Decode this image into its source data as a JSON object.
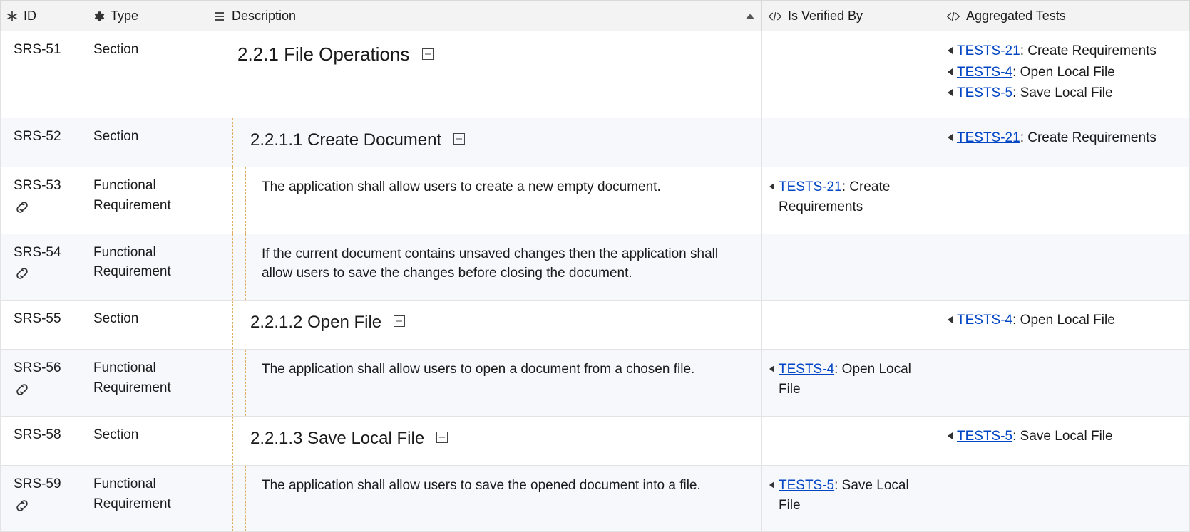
{
  "columns": {
    "id": "ID",
    "type": "Type",
    "description": "Description",
    "is_verified_by": "Is Verified By",
    "aggregated_tests": "Aggregated Tests"
  },
  "rows": [
    {
      "id": "SRS-51",
      "type": "Section",
      "linked": false,
      "level": "h1",
      "guides": 1,
      "heading_no": "2.2.1",
      "heading_text": "File Operations",
      "collapsible": true,
      "verified_by": [],
      "aggregated": [
        {
          "id": "TESTS-21",
          "label": "Create Requirements"
        },
        {
          "id": "TESTS-4",
          "label": "Open Local File"
        },
        {
          "id": "TESTS-5",
          "label": "Save Local File"
        }
      ]
    },
    {
      "id": "SRS-52",
      "type": "Section",
      "linked": false,
      "level": "h2",
      "guides": 2,
      "heading_no": "2.2.1.1",
      "heading_text": "Create Document",
      "collapsible": true,
      "verified_by": [],
      "aggregated": [
        {
          "id": "TESTS-21",
          "label": "Create Requirements"
        }
      ]
    },
    {
      "id": "SRS-53",
      "type": "Functional Requirement",
      "linked": true,
      "level": "txt",
      "guides": 3,
      "text": "The application shall allow users to create a new empty document.",
      "verified_by": [
        {
          "id": "TESTS-21",
          "label": "Create Requirements"
        }
      ],
      "aggregated": []
    },
    {
      "id": "SRS-54",
      "type": "Functional Requirement",
      "linked": true,
      "level": "txt",
      "guides": 3,
      "text": "If the current document contains unsaved changes then the application shall allow users to save the changes before closing the document.",
      "verified_by": [],
      "aggregated": []
    },
    {
      "id": "SRS-55",
      "type": "Section",
      "linked": false,
      "level": "h2",
      "guides": 2,
      "heading_no": "2.2.1.2",
      "heading_text": "Open File",
      "collapsible": true,
      "verified_by": [],
      "aggregated": [
        {
          "id": "TESTS-4",
          "label": "Open Local File"
        }
      ]
    },
    {
      "id": "SRS-56",
      "type": "Functional Requirement",
      "linked": true,
      "level": "txt",
      "guides": 3,
      "text": "The application shall allow users to open a document from a chosen file.",
      "verified_by": [
        {
          "id": "TESTS-4",
          "label": "Open Local File"
        }
      ],
      "aggregated": []
    },
    {
      "id": "SRS-58",
      "type": "Section",
      "linked": false,
      "level": "h2",
      "guides": 2,
      "heading_no": "2.2.1.3",
      "heading_text": "Save Local File",
      "collapsible": true,
      "verified_by": [],
      "aggregated": [
        {
          "id": "TESTS-5",
          "label": "Save Local File"
        }
      ]
    },
    {
      "id": "SRS-59",
      "type": "Functional Requirement",
      "linked": true,
      "level": "txt",
      "guides": 3,
      "text": "The application shall allow users to save the opened document into a file.",
      "verified_by": [
        {
          "id": "TESTS-5",
          "label": "Save Local File"
        }
      ],
      "aggregated": []
    }
  ]
}
